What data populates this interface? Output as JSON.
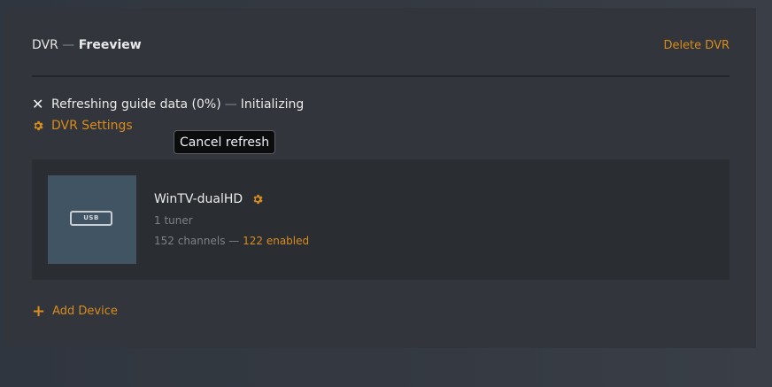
{
  "header": {
    "dvr_label": "DVR",
    "separator": "—",
    "provider": "Freeview",
    "delete_label": "Delete DVR"
  },
  "status": {
    "cancel_icon": "close-icon",
    "text": "Refreshing guide data (0%)",
    "separator": "—",
    "state": "Initializing"
  },
  "settings": {
    "icon": "gear-icon",
    "label": "DVR Settings"
  },
  "tooltip": {
    "text": "Cancel refresh"
  },
  "device": {
    "thumb_label": "USB",
    "name": "WinTV-dualHD",
    "tuners": "1 tuner",
    "channels": "152 channels",
    "separator": "—",
    "enabled": "122 enabled"
  },
  "add_device": {
    "icon": "plus-icon",
    "label": "Add Device"
  },
  "colors": {
    "accent": "#d88c1c",
    "panel": "#32353b",
    "card": "#2a2d32",
    "thumb": "#415463"
  }
}
